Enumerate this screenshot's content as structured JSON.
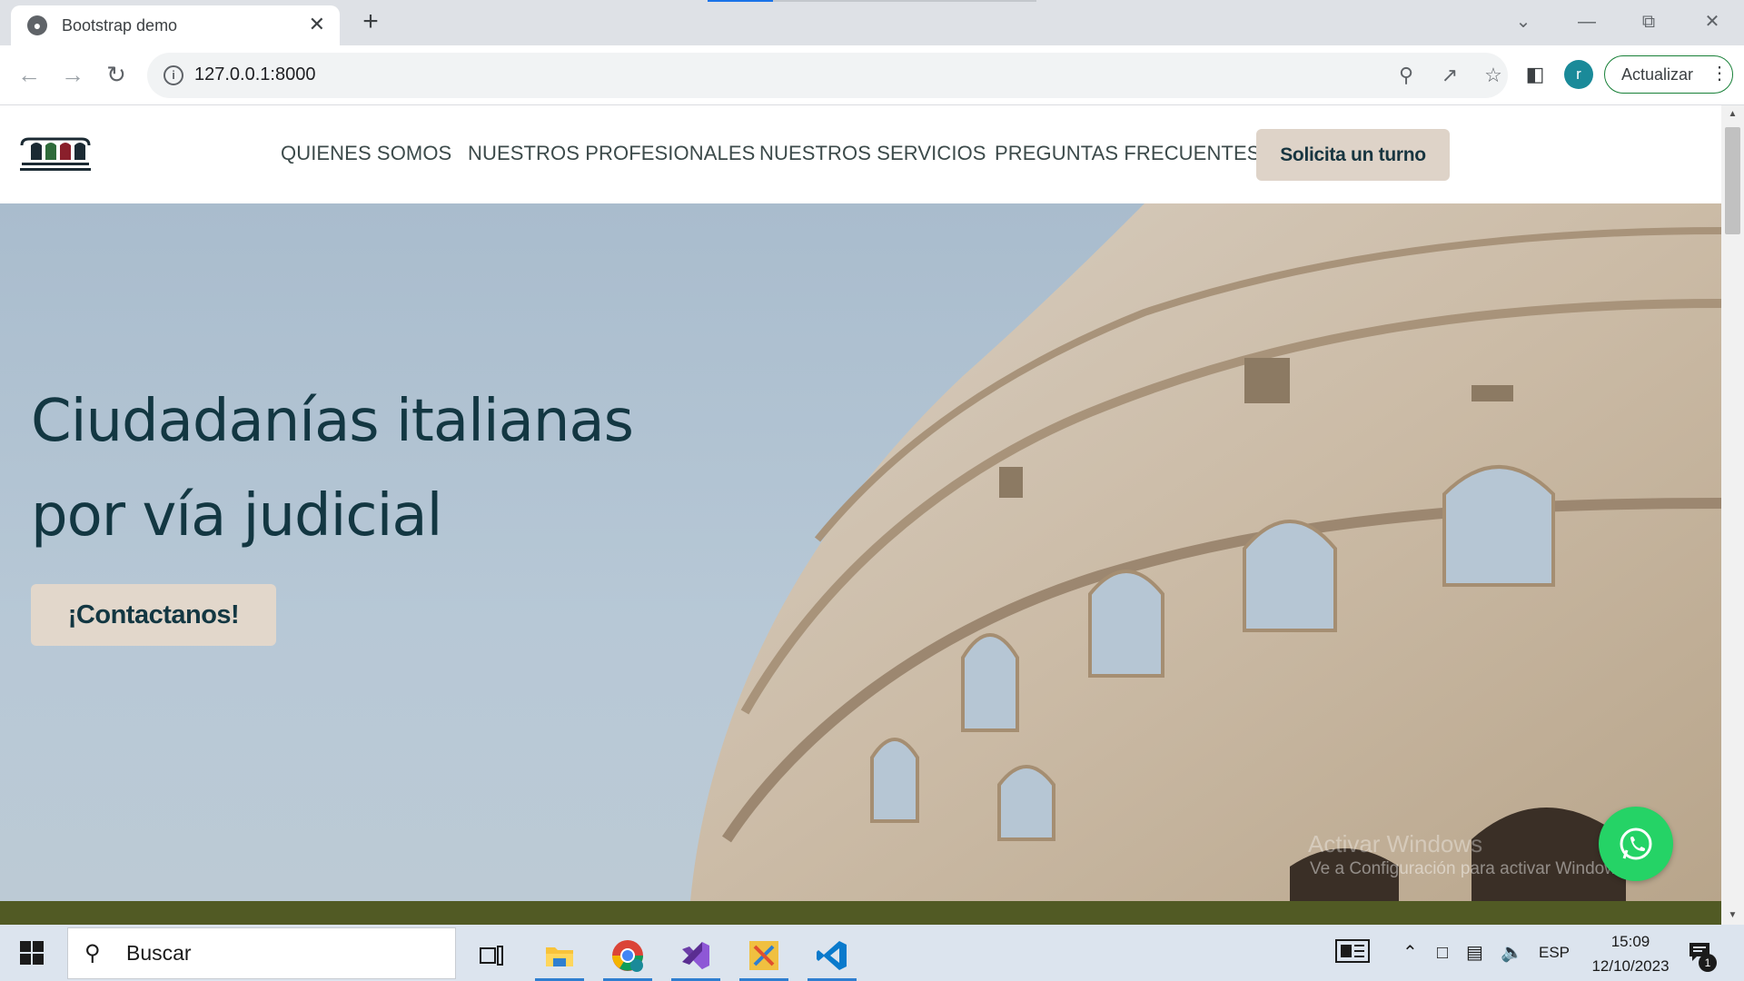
{
  "browser": {
    "tab_title": "Bootstrap demo",
    "tab_close": "✕",
    "new_tab": "+",
    "url": "127.0.0.1:8000",
    "profile_initial": "r",
    "update_label": "Actualizar"
  },
  "site": {
    "nav_links": [
      "QUIENES SOMOS",
      "NUESTROS PROFESIONALES",
      "NUESTROS SERVICIOS",
      "PREGUNTAS FRECUENTES"
    ],
    "cta_label": "Solicita un turno",
    "hero": {
      "title_line1": "Ciudadanías italianas",
      "title_line2": "por vía judicial",
      "button_label": "¡Contactanos!"
    },
    "watermark": {
      "line1": "Activar Windows",
      "line2": "Ve a Configuración para activar Windows."
    },
    "colors": {
      "footer_strip": "#515a24",
      "cta_bg": "#ded3c8",
      "title": "#133742",
      "whatsapp": "#25d366"
    }
  },
  "taskbar": {
    "search_placeholder": "Buscar",
    "language": "ESP",
    "time": "15:09",
    "date": "12/10/2023",
    "notification_count": "1",
    "pinned_apps": [
      "task-view-icon",
      "file-explorer-icon",
      "chrome-icon",
      "visual-studio-icon",
      "app-icon",
      "vscode-icon"
    ]
  }
}
